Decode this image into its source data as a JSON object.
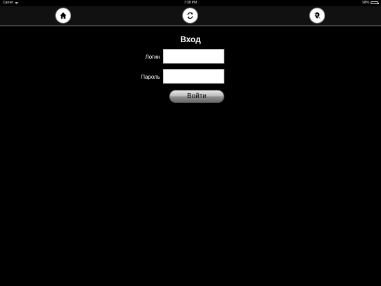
{
  "status_bar": {
    "carrier": "Carrier",
    "time": "7:38 PM",
    "battery_percent": "98%",
    "battery_level": 0.98,
    "icons": [
      "wifi-icon",
      "battery-icon"
    ]
  },
  "toolbar": {
    "buttons": [
      {
        "icon": "home-icon"
      },
      {
        "icon": "refresh-icon"
      },
      {
        "icon": "location-off-icon"
      }
    ]
  },
  "login": {
    "title": "Вход",
    "login_label": "Логин",
    "login_value": "",
    "password_label": "Пароль",
    "password_value": "",
    "submit_label": "Войти"
  },
  "colors": {
    "background": "#000000",
    "button_fill": "#ffffff",
    "divider": "#8a8a8a"
  }
}
